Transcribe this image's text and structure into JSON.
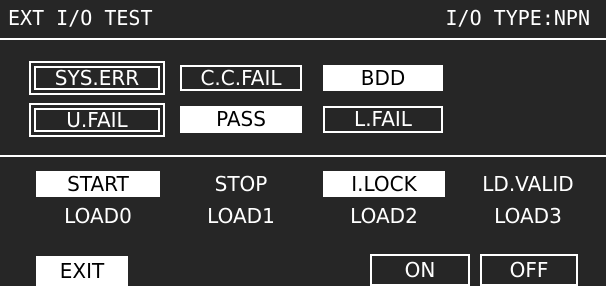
{
  "header": {
    "title": "EXT I/O TEST",
    "io_type": "I/O TYPE:NPN"
  },
  "status_indicators": {
    "sys_err": "SYS.ERR",
    "cc_fail": "C.C.FAIL",
    "bdd": "BDD",
    "u_fail": "U.FAIL",
    "pass": "PASS",
    "l_fail": "L.FAIL"
  },
  "inputs": {
    "start": "START",
    "stop": "STOP",
    "ilock": "I.LOCK",
    "ld_valid": "LD.VALID",
    "load0": "LOAD0",
    "load1": "LOAD1",
    "load2": "LOAD2",
    "load3": "LOAD3"
  },
  "buttons": {
    "exit": "EXIT",
    "on": "ON",
    "off": "OFF"
  },
  "colors": {
    "background": "#262626",
    "foreground": "#ffffff"
  }
}
